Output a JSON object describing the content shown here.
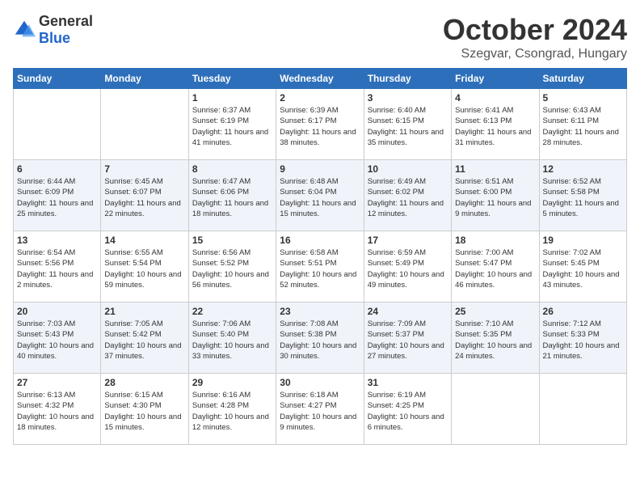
{
  "logo": {
    "general": "General",
    "blue": "Blue"
  },
  "title": "October 2024",
  "location": "Szegvar, Csongrad, Hungary",
  "days_of_week": [
    "Sunday",
    "Monday",
    "Tuesday",
    "Wednesday",
    "Thursday",
    "Friday",
    "Saturday"
  ],
  "weeks": [
    [
      {
        "day": "",
        "info": ""
      },
      {
        "day": "",
        "info": ""
      },
      {
        "day": "1",
        "info": "Sunrise: 6:37 AM\nSunset: 6:19 PM\nDaylight: 11 hours and 41 minutes."
      },
      {
        "day": "2",
        "info": "Sunrise: 6:39 AM\nSunset: 6:17 PM\nDaylight: 11 hours and 38 minutes."
      },
      {
        "day": "3",
        "info": "Sunrise: 6:40 AM\nSunset: 6:15 PM\nDaylight: 11 hours and 35 minutes."
      },
      {
        "day": "4",
        "info": "Sunrise: 6:41 AM\nSunset: 6:13 PM\nDaylight: 11 hours and 31 minutes."
      },
      {
        "day": "5",
        "info": "Sunrise: 6:43 AM\nSunset: 6:11 PM\nDaylight: 11 hours and 28 minutes."
      }
    ],
    [
      {
        "day": "6",
        "info": "Sunrise: 6:44 AM\nSunset: 6:09 PM\nDaylight: 11 hours and 25 minutes."
      },
      {
        "day": "7",
        "info": "Sunrise: 6:45 AM\nSunset: 6:07 PM\nDaylight: 11 hours and 22 minutes."
      },
      {
        "day": "8",
        "info": "Sunrise: 6:47 AM\nSunset: 6:06 PM\nDaylight: 11 hours and 18 minutes."
      },
      {
        "day": "9",
        "info": "Sunrise: 6:48 AM\nSunset: 6:04 PM\nDaylight: 11 hours and 15 minutes."
      },
      {
        "day": "10",
        "info": "Sunrise: 6:49 AM\nSunset: 6:02 PM\nDaylight: 11 hours and 12 minutes."
      },
      {
        "day": "11",
        "info": "Sunrise: 6:51 AM\nSunset: 6:00 PM\nDaylight: 11 hours and 9 minutes."
      },
      {
        "day": "12",
        "info": "Sunrise: 6:52 AM\nSunset: 5:58 PM\nDaylight: 11 hours and 5 minutes."
      }
    ],
    [
      {
        "day": "13",
        "info": "Sunrise: 6:54 AM\nSunset: 5:56 PM\nDaylight: 11 hours and 2 minutes."
      },
      {
        "day": "14",
        "info": "Sunrise: 6:55 AM\nSunset: 5:54 PM\nDaylight: 10 hours and 59 minutes."
      },
      {
        "day": "15",
        "info": "Sunrise: 6:56 AM\nSunset: 5:52 PM\nDaylight: 10 hours and 56 minutes."
      },
      {
        "day": "16",
        "info": "Sunrise: 6:58 AM\nSunset: 5:51 PM\nDaylight: 10 hours and 52 minutes."
      },
      {
        "day": "17",
        "info": "Sunrise: 6:59 AM\nSunset: 5:49 PM\nDaylight: 10 hours and 49 minutes."
      },
      {
        "day": "18",
        "info": "Sunrise: 7:00 AM\nSunset: 5:47 PM\nDaylight: 10 hours and 46 minutes."
      },
      {
        "day": "19",
        "info": "Sunrise: 7:02 AM\nSunset: 5:45 PM\nDaylight: 10 hours and 43 minutes."
      }
    ],
    [
      {
        "day": "20",
        "info": "Sunrise: 7:03 AM\nSunset: 5:43 PM\nDaylight: 10 hours and 40 minutes."
      },
      {
        "day": "21",
        "info": "Sunrise: 7:05 AM\nSunset: 5:42 PM\nDaylight: 10 hours and 37 minutes."
      },
      {
        "day": "22",
        "info": "Sunrise: 7:06 AM\nSunset: 5:40 PM\nDaylight: 10 hours and 33 minutes."
      },
      {
        "day": "23",
        "info": "Sunrise: 7:08 AM\nSunset: 5:38 PM\nDaylight: 10 hours and 30 minutes."
      },
      {
        "day": "24",
        "info": "Sunrise: 7:09 AM\nSunset: 5:37 PM\nDaylight: 10 hours and 27 minutes."
      },
      {
        "day": "25",
        "info": "Sunrise: 7:10 AM\nSunset: 5:35 PM\nDaylight: 10 hours and 24 minutes."
      },
      {
        "day": "26",
        "info": "Sunrise: 7:12 AM\nSunset: 5:33 PM\nDaylight: 10 hours and 21 minutes."
      }
    ],
    [
      {
        "day": "27",
        "info": "Sunrise: 6:13 AM\nSunset: 4:32 PM\nDaylight: 10 hours and 18 minutes."
      },
      {
        "day": "28",
        "info": "Sunrise: 6:15 AM\nSunset: 4:30 PM\nDaylight: 10 hours and 15 minutes."
      },
      {
        "day": "29",
        "info": "Sunrise: 6:16 AM\nSunset: 4:28 PM\nDaylight: 10 hours and 12 minutes."
      },
      {
        "day": "30",
        "info": "Sunrise: 6:18 AM\nSunset: 4:27 PM\nDaylight: 10 hours and 9 minutes."
      },
      {
        "day": "31",
        "info": "Sunrise: 6:19 AM\nSunset: 4:25 PM\nDaylight: 10 hours and 6 minutes."
      },
      {
        "day": "",
        "info": ""
      },
      {
        "day": "",
        "info": ""
      }
    ]
  ]
}
